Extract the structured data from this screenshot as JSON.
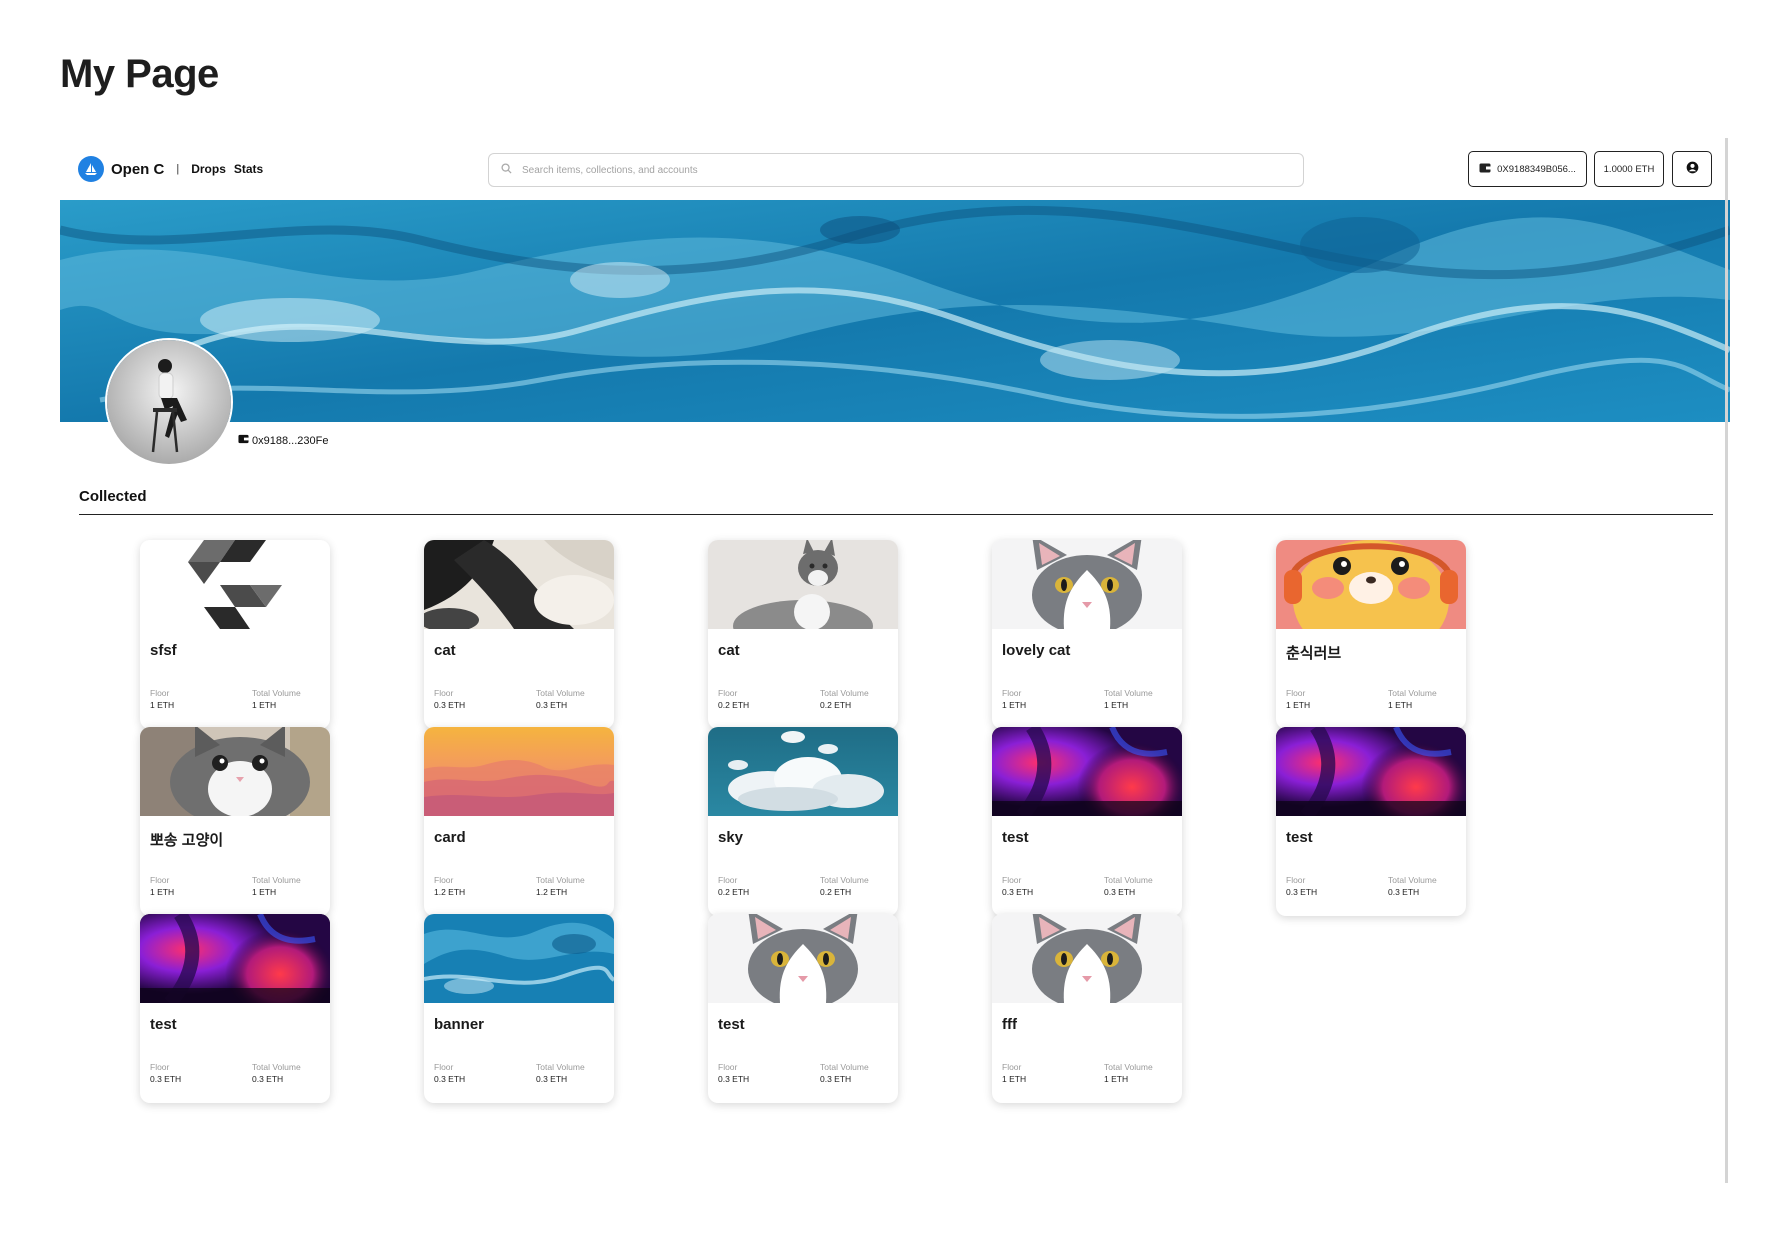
{
  "page": {
    "title": "My Page"
  },
  "navbar": {
    "brand": "Open C",
    "separator": "|",
    "links": [
      "Drops",
      "Stats"
    ],
    "search_placeholder": "Search items, collections, and accounts",
    "wallet_label": "0X9188349B056...",
    "balance_label": "1.0000 ETH"
  },
  "profile": {
    "address": "0x9188...230Fe"
  },
  "collected": {
    "title": "Collected",
    "floor_label": "Floor",
    "volume_label": "Total Volume",
    "items": [
      {
        "name": "sfsf",
        "floor": "1 ETH",
        "volume": "1 ETH",
        "art": "solidity-logo"
      },
      {
        "name": "cat",
        "floor": "0.3 ETH",
        "volume": "0.3 ETH",
        "art": "black-white-fur"
      },
      {
        "name": "cat",
        "floor": "0.2 ETH",
        "volume": "0.2 ETH",
        "art": "cat-looking-up"
      },
      {
        "name": "lovely cat",
        "floor": "1 ETH",
        "volume": "1 ETH",
        "art": "grey-white-cat"
      },
      {
        "name": "춘식러브",
        "floor": "1 ETH",
        "volume": "1 ETH",
        "art": "yellow-character"
      },
      {
        "name": "뽀송 고양이",
        "floor": "1 ETH",
        "volume": "1 ETH",
        "art": "fluffy-kitten"
      },
      {
        "name": "card",
        "floor": "1.2 ETH",
        "volume": "1.2 ETH",
        "art": "sunset-mountains"
      },
      {
        "name": "sky",
        "floor": "0.2 ETH",
        "volume": "0.2 ETH",
        "art": "clouds-sky"
      },
      {
        "name": "test",
        "floor": "0.3 ETH",
        "volume": "0.3 ETH",
        "art": "neon-gradient"
      },
      {
        "name": "test",
        "floor": "0.3 ETH",
        "volume": "0.3 ETH",
        "art": "neon-gradient"
      },
      {
        "name": "test",
        "floor": "0.3 ETH",
        "volume": "0.3 ETH",
        "art": "neon-gradient"
      },
      {
        "name": "banner",
        "floor": "0.3 ETH",
        "volume": "0.3 ETH",
        "art": "blue-marble"
      },
      {
        "name": "test",
        "floor": "0.3 ETH",
        "volume": "0.3 ETH",
        "art": "grey-white-cat"
      },
      {
        "name": "fff",
        "floor": "1 ETH",
        "volume": "1 ETH",
        "art": "grey-white-cat"
      }
    ]
  },
  "colors": {
    "brand": "#2081e2",
    "banner": "#1a86b8",
    "text": "#111111"
  }
}
